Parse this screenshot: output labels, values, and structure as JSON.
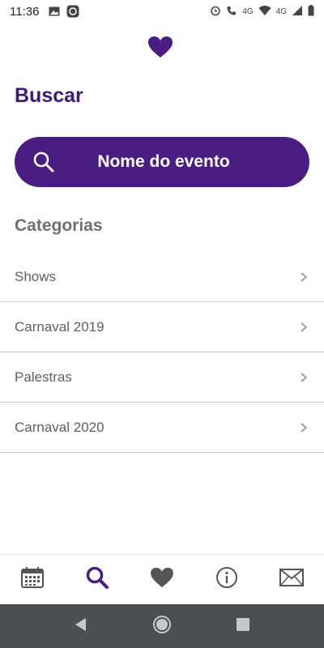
{
  "status_bar": {
    "time": "11:36",
    "icons": [
      "image-icon",
      "app-notification-icon",
      "alarm-icon",
      "wifi-calling-icon",
      "wifi-icon",
      "signal-icon",
      "battery-icon"
    ],
    "network_label_1": "4G",
    "network_label_2": "4G"
  },
  "header": {
    "logo_icon": "heart-icon",
    "title": "Buscar"
  },
  "search": {
    "label": "Nome do evento",
    "icon": "search-icon"
  },
  "categories": {
    "title": "Categorias",
    "items": [
      {
        "label": "Shows"
      },
      {
        "label": "Carnaval 2019"
      },
      {
        "label": "Palestras"
      },
      {
        "label": "Carnaval 2020"
      }
    ]
  },
  "bottom_nav": {
    "items": [
      "calendar-icon",
      "search-icon",
      "heart-icon",
      "info-icon",
      "mail-icon"
    ],
    "active": "search-icon"
  },
  "colors": {
    "brand": "#4a1d82",
    "title": "#3d1a78",
    "muted": "#707070",
    "divider": "#c9c9c9"
  }
}
